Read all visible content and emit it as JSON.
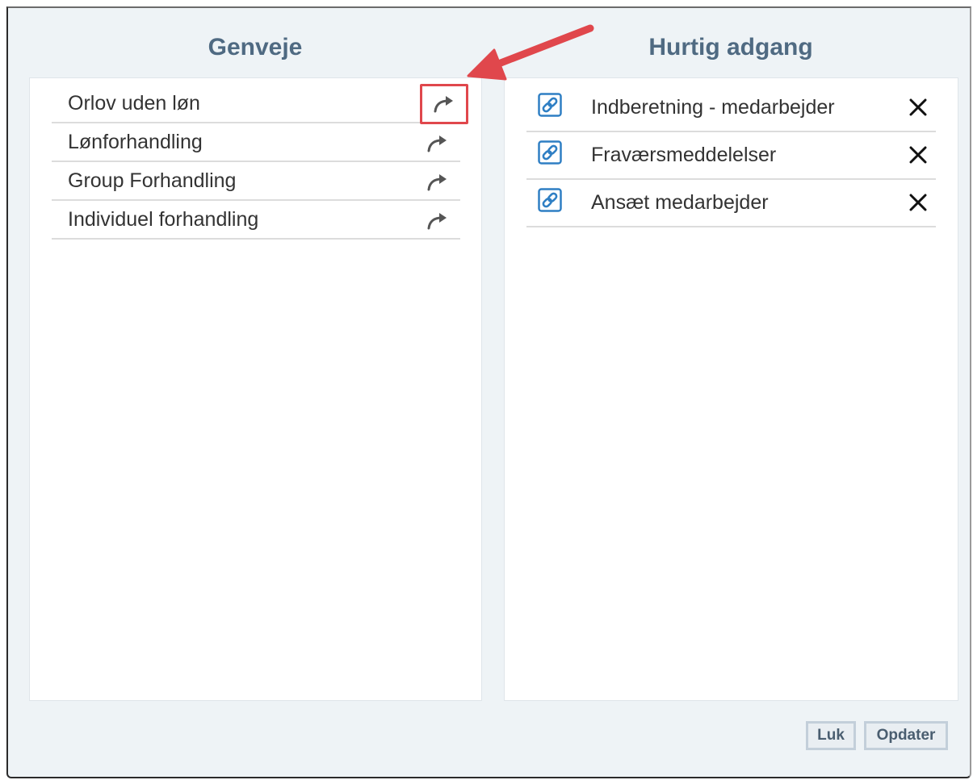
{
  "shortcuts": {
    "title": "Genveje",
    "items": [
      {
        "label": "Orlov uden løn"
      },
      {
        "label": "Lønforhandling"
      },
      {
        "label": "Group Forhandling"
      },
      {
        "label": "Individuel forhandling"
      }
    ]
  },
  "quick_access": {
    "title": "Hurtig adgang",
    "items": [
      {
        "label": "Indberetning - medarbejder"
      },
      {
        "label": "Fraværsmeddelelser"
      },
      {
        "label": "Ansæt medarbejder"
      }
    ]
  },
  "footer": {
    "close_label": "Luk",
    "update_label": "Opdater"
  },
  "colors": {
    "title_text": "#4f6a82",
    "annotation_red": "#e0474c",
    "link_icon_blue": "#2f7fc4"
  },
  "icons": {
    "shortcut_action": "share-arrow-icon",
    "quick_link": "link-icon",
    "quick_remove": "close-x-icon"
  }
}
